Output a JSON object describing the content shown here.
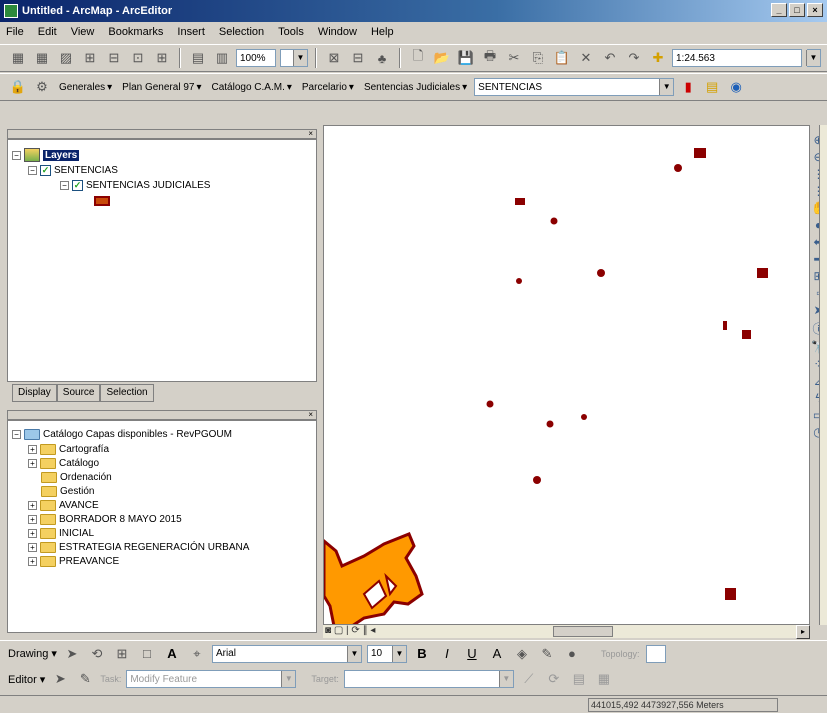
{
  "window": {
    "title": "Untitled - ArcMap - ArcEditor"
  },
  "menu": [
    "File",
    "Edit",
    "View",
    "Bookmarks",
    "Insert",
    "Selection",
    "Tools",
    "Window",
    "Help"
  ],
  "toolbar1": {
    "scale": "1:24.563",
    "zoom": "100%"
  },
  "toolbar2": {
    "generales": "Generales",
    "plan_general": "Plan General 97",
    "catalogo": "Catálogo C.A.M.",
    "parcelario": "Parcelario",
    "sentencias_menu": "Sentencias Judiciales",
    "sentencias_combo": "SENTENCIAS"
  },
  "toc": {
    "layers_label": "Layers",
    "group": "SENTENCIAS",
    "layer": "SENTENCIAS JUDICIALES",
    "tabs": [
      "Display",
      "Source",
      "Selection"
    ]
  },
  "catalog": {
    "root": "Catálogo Capas disponibles - RevPGOUM",
    "items": [
      "Cartografía",
      "Catálogo",
      "Ordenación",
      "Gestión",
      "AVANCE",
      "BORRADOR 8 MAYO 2015",
      "INICIAL",
      "ESTRATEGIA REGENERACIÓN URBANA",
      "PREAVANCE"
    ]
  },
  "drawing": {
    "label": "Drawing",
    "font": "Arial",
    "size": "10",
    "topology": "Topology:"
  },
  "editor": {
    "label": "Editor",
    "task_label": "Task:",
    "task": "Modify Feature",
    "target_label": "Target:"
  },
  "status": {
    "coordinates": "441015,492  4473927,556 Meters"
  },
  "colors": {
    "feature_fill": "#8b0000",
    "polygon_fill": "#ff9900",
    "polygon_outline": "#8b0000"
  }
}
